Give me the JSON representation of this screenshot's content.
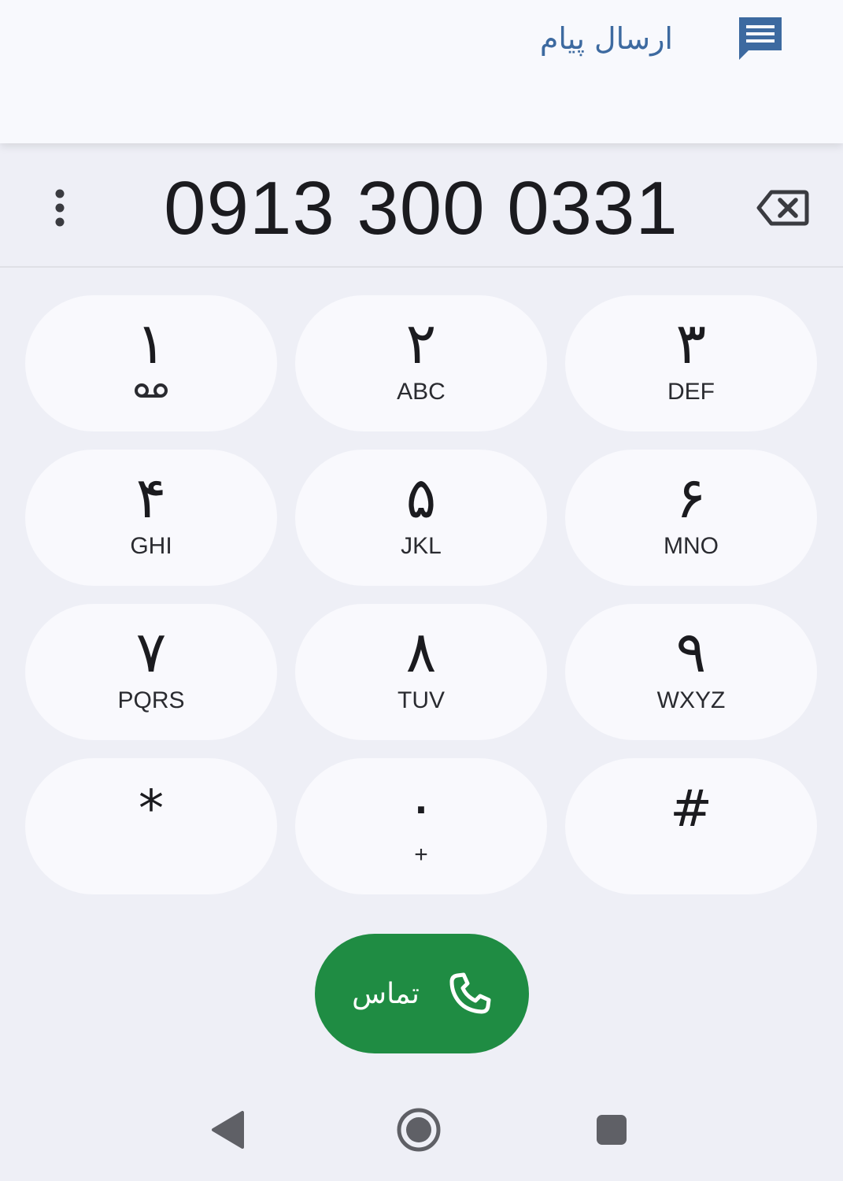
{
  "top_bar": {
    "send_message_label": "ارسال پیام",
    "message_icon": "message-icon"
  },
  "dialer": {
    "number": "0913 300 0331",
    "more_icon": "more-vert-icon",
    "backspace_icon": "backspace-icon"
  },
  "keys": [
    {
      "digit": "۱",
      "letters": "",
      "icon": "voicemail-icon"
    },
    {
      "digit": "۲",
      "letters": "ABC"
    },
    {
      "digit": "۳",
      "letters": "DEF"
    },
    {
      "digit": "۴",
      "letters": "GHI"
    },
    {
      "digit": "۵",
      "letters": "JKL"
    },
    {
      "digit": "۶",
      "letters": "MNO"
    },
    {
      "digit": "۷",
      "letters": "PQRS"
    },
    {
      "digit": "۸",
      "letters": "TUV"
    },
    {
      "digit": "۹",
      "letters": "WXYZ"
    },
    {
      "digit": "*",
      "letters": ""
    },
    {
      "digit": "۰",
      "letters": "+"
    },
    {
      "digit": "#",
      "letters": ""
    }
  ],
  "call": {
    "label": "تماس",
    "icon": "phone-icon"
  },
  "nav": {
    "back_icon": "back-icon",
    "home_icon": "home-icon",
    "recents_icon": "recents-icon"
  },
  "colors": {
    "accent_blue": "#3d6aa0",
    "call_green": "#1f8c43",
    "background": "#eeeff6",
    "key_background": "#f9f9fd"
  }
}
